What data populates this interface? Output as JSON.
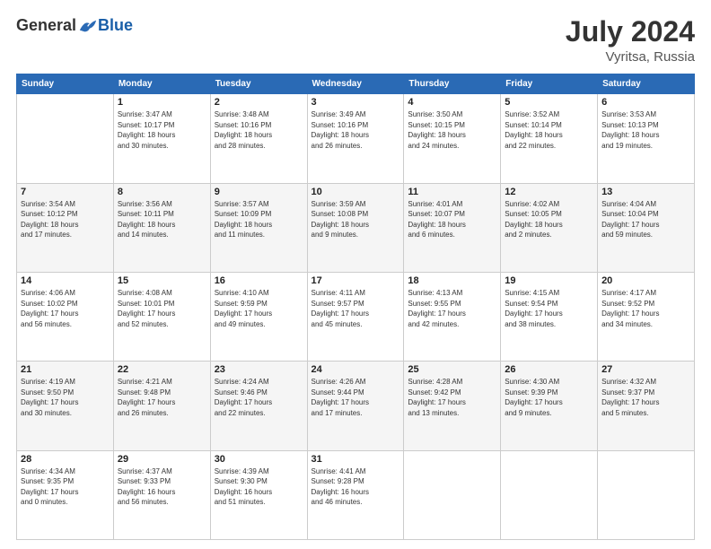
{
  "logo": {
    "general": "General",
    "blue": "Blue"
  },
  "title": {
    "month": "July 2024",
    "location": "Vyritsa, Russia"
  },
  "weekdays": [
    "Sunday",
    "Monday",
    "Tuesday",
    "Wednesday",
    "Thursday",
    "Friday",
    "Saturday"
  ],
  "weeks": [
    [
      {
        "day": "",
        "info": ""
      },
      {
        "day": "1",
        "info": "Sunrise: 3:47 AM\nSunset: 10:17 PM\nDaylight: 18 hours\nand 30 minutes."
      },
      {
        "day": "2",
        "info": "Sunrise: 3:48 AM\nSunset: 10:16 PM\nDaylight: 18 hours\nand 28 minutes."
      },
      {
        "day": "3",
        "info": "Sunrise: 3:49 AM\nSunset: 10:16 PM\nDaylight: 18 hours\nand 26 minutes."
      },
      {
        "day": "4",
        "info": "Sunrise: 3:50 AM\nSunset: 10:15 PM\nDaylight: 18 hours\nand 24 minutes."
      },
      {
        "day": "5",
        "info": "Sunrise: 3:52 AM\nSunset: 10:14 PM\nDaylight: 18 hours\nand 22 minutes."
      },
      {
        "day": "6",
        "info": "Sunrise: 3:53 AM\nSunset: 10:13 PM\nDaylight: 18 hours\nand 19 minutes."
      }
    ],
    [
      {
        "day": "7",
        "info": "Sunrise: 3:54 AM\nSunset: 10:12 PM\nDaylight: 18 hours\nand 17 minutes."
      },
      {
        "day": "8",
        "info": "Sunrise: 3:56 AM\nSunset: 10:11 PM\nDaylight: 18 hours\nand 14 minutes."
      },
      {
        "day": "9",
        "info": "Sunrise: 3:57 AM\nSunset: 10:09 PM\nDaylight: 18 hours\nand 11 minutes."
      },
      {
        "day": "10",
        "info": "Sunrise: 3:59 AM\nSunset: 10:08 PM\nDaylight: 18 hours\nand 9 minutes."
      },
      {
        "day": "11",
        "info": "Sunrise: 4:01 AM\nSunset: 10:07 PM\nDaylight: 18 hours\nand 6 minutes."
      },
      {
        "day": "12",
        "info": "Sunrise: 4:02 AM\nSunset: 10:05 PM\nDaylight: 18 hours\nand 2 minutes."
      },
      {
        "day": "13",
        "info": "Sunrise: 4:04 AM\nSunset: 10:04 PM\nDaylight: 17 hours\nand 59 minutes."
      }
    ],
    [
      {
        "day": "14",
        "info": "Sunrise: 4:06 AM\nSunset: 10:02 PM\nDaylight: 17 hours\nand 56 minutes."
      },
      {
        "day": "15",
        "info": "Sunrise: 4:08 AM\nSunset: 10:01 PM\nDaylight: 17 hours\nand 52 minutes."
      },
      {
        "day": "16",
        "info": "Sunrise: 4:10 AM\nSunset: 9:59 PM\nDaylight: 17 hours\nand 49 minutes."
      },
      {
        "day": "17",
        "info": "Sunrise: 4:11 AM\nSunset: 9:57 PM\nDaylight: 17 hours\nand 45 minutes."
      },
      {
        "day": "18",
        "info": "Sunrise: 4:13 AM\nSunset: 9:55 PM\nDaylight: 17 hours\nand 42 minutes."
      },
      {
        "day": "19",
        "info": "Sunrise: 4:15 AM\nSunset: 9:54 PM\nDaylight: 17 hours\nand 38 minutes."
      },
      {
        "day": "20",
        "info": "Sunrise: 4:17 AM\nSunset: 9:52 PM\nDaylight: 17 hours\nand 34 minutes."
      }
    ],
    [
      {
        "day": "21",
        "info": "Sunrise: 4:19 AM\nSunset: 9:50 PM\nDaylight: 17 hours\nand 30 minutes."
      },
      {
        "day": "22",
        "info": "Sunrise: 4:21 AM\nSunset: 9:48 PM\nDaylight: 17 hours\nand 26 minutes."
      },
      {
        "day": "23",
        "info": "Sunrise: 4:24 AM\nSunset: 9:46 PM\nDaylight: 17 hours\nand 22 minutes."
      },
      {
        "day": "24",
        "info": "Sunrise: 4:26 AM\nSunset: 9:44 PM\nDaylight: 17 hours\nand 17 minutes."
      },
      {
        "day": "25",
        "info": "Sunrise: 4:28 AM\nSunset: 9:42 PM\nDaylight: 17 hours\nand 13 minutes."
      },
      {
        "day": "26",
        "info": "Sunrise: 4:30 AM\nSunset: 9:39 PM\nDaylight: 17 hours\nand 9 minutes."
      },
      {
        "day": "27",
        "info": "Sunrise: 4:32 AM\nSunset: 9:37 PM\nDaylight: 17 hours\nand 5 minutes."
      }
    ],
    [
      {
        "day": "28",
        "info": "Sunrise: 4:34 AM\nSunset: 9:35 PM\nDaylight: 17 hours\nand 0 minutes."
      },
      {
        "day": "29",
        "info": "Sunrise: 4:37 AM\nSunset: 9:33 PM\nDaylight: 16 hours\nand 56 minutes."
      },
      {
        "day": "30",
        "info": "Sunrise: 4:39 AM\nSunset: 9:30 PM\nDaylight: 16 hours\nand 51 minutes."
      },
      {
        "day": "31",
        "info": "Sunrise: 4:41 AM\nSunset: 9:28 PM\nDaylight: 16 hours\nand 46 minutes."
      },
      {
        "day": "",
        "info": ""
      },
      {
        "day": "",
        "info": ""
      },
      {
        "day": "",
        "info": ""
      }
    ]
  ]
}
